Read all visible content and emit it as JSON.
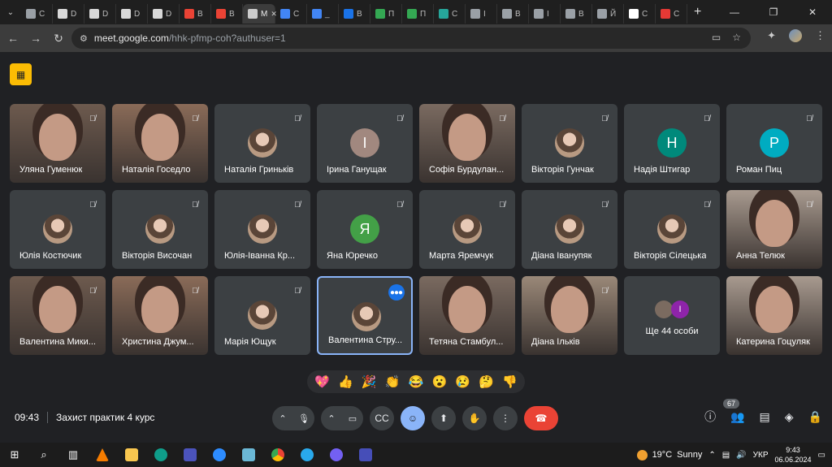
{
  "browser": {
    "tabs": [
      {
        "label": "C",
        "color": "#9aa0a6"
      },
      {
        "label": "D",
        "color": "#d9d9d9"
      },
      {
        "label": "D",
        "color": "#d9d9d9"
      },
      {
        "label": "D",
        "color": "#d9d9d9"
      },
      {
        "label": "D",
        "color": "#d9d9d9"
      },
      {
        "label": "B",
        "color": "#ea4335"
      },
      {
        "label": "B",
        "color": "#ea4335"
      },
      {
        "label": "M",
        "color": "#cccccc",
        "active": true
      },
      {
        "label": "C",
        "color": "#4285f4"
      },
      {
        "label": "_",
        "color": "#4285f4"
      },
      {
        "label": "B",
        "color": "#1a73e8"
      },
      {
        "label": "П",
        "color": "#34a853"
      },
      {
        "label": "П",
        "color": "#34a853"
      },
      {
        "label": "C",
        "color": "#26a69a"
      },
      {
        "label": "I",
        "color": "#9aa0a6"
      },
      {
        "label": "B",
        "color": "#9aa0a6"
      },
      {
        "label": "I",
        "color": "#9aa0a6"
      },
      {
        "label": "B",
        "color": "#9aa0a6"
      },
      {
        "label": "Й",
        "color": "#9aa0a6"
      },
      {
        "label": "C",
        "color": "#ffffff"
      },
      {
        "label": "C",
        "color": "#e53935"
      }
    ],
    "new_tab": "+",
    "url_host": "meet.google.com",
    "url_path": "/hhk-pfmp-coh?authuser=1"
  },
  "participants": [
    {
      "name": "Уляна Гуменюк",
      "kind": "video",
      "muted": true
    },
    {
      "name": "Наталія Госедло",
      "kind": "video",
      "muted": true
    },
    {
      "name": "Наталія Гриньків",
      "kind": "photo",
      "muted": true
    },
    {
      "name": "Ірина Ганущак",
      "kind": "letter",
      "letter": "І",
      "color": "#a1887f",
      "muted": true
    },
    {
      "name": "Софія Бурдулан...",
      "kind": "video",
      "muted": true
    },
    {
      "name": "Вікторія Гунчак",
      "kind": "photo",
      "muted": true
    },
    {
      "name": "Надія Штигар",
      "kind": "letter",
      "letter": "Н",
      "color": "#00897b",
      "muted": true
    },
    {
      "name": "Роман Пиц",
      "kind": "letter",
      "letter": "P",
      "color": "#00acc1",
      "muted": true
    },
    {
      "name": "Юлія Костючик",
      "kind": "photo",
      "muted": true
    },
    {
      "name": "Вікторія Височан",
      "kind": "photo",
      "muted": true
    },
    {
      "name": "Юлія-Іванна Кр...",
      "kind": "photo",
      "muted": true
    },
    {
      "name": "Яна Юречко",
      "kind": "letter",
      "letter": "Я",
      "color": "#43a047",
      "muted": true
    },
    {
      "name": "Марта Яремчук",
      "kind": "photo",
      "muted": true
    },
    {
      "name": "Діана Іванупяк",
      "kind": "photo",
      "muted": true
    },
    {
      "name": "Вікторія Сілецька",
      "kind": "photo",
      "muted": true
    },
    {
      "name": "Анна Телюк",
      "kind": "video",
      "muted": true
    },
    {
      "name": "Валентина Мики...",
      "kind": "video",
      "muted": true
    },
    {
      "name": "Христина Джум...",
      "kind": "video",
      "muted": true
    },
    {
      "name": "Марія Ющук",
      "kind": "photo",
      "muted": true
    },
    {
      "name": "Валентина Стру...",
      "kind": "photo",
      "speaking": true
    },
    {
      "name": "Тетяна Стамбул...",
      "kind": "video",
      "muted": false
    },
    {
      "name": "Діана Ільків",
      "kind": "video",
      "muted": true
    },
    {
      "name": "Ще 44 особи",
      "kind": "more",
      "letter": "І"
    },
    {
      "name": "Катерина Гоцуляк",
      "kind": "video",
      "muted": false
    }
  ],
  "reactions": [
    "💖",
    "👍",
    "🎉",
    "👏",
    "😂",
    "😮",
    "😢",
    "🤔",
    "👎"
  ],
  "meeting": {
    "time": "09:43",
    "title": "Захист практик 4 курс",
    "people_count": "67"
  },
  "taskbar": {
    "weather_temp": "19°C",
    "weather_text": "Sunny",
    "lang": "УКР",
    "time": "9:43",
    "date": "06.06.2024"
  }
}
